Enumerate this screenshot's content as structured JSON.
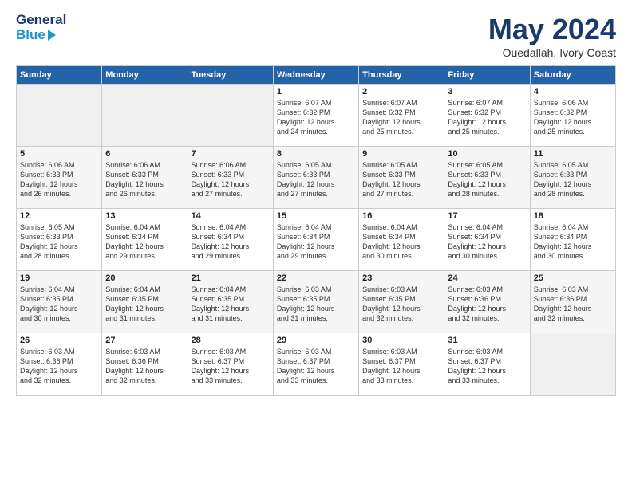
{
  "logo": {
    "line1": "General",
    "line2": "Blue"
  },
  "title": "May 2024",
  "location": "Ouedallah, Ivory Coast",
  "days_of_week": [
    "Sunday",
    "Monday",
    "Tuesday",
    "Wednesday",
    "Thursday",
    "Friday",
    "Saturday"
  ],
  "weeks": [
    [
      {
        "day": "",
        "info": ""
      },
      {
        "day": "",
        "info": ""
      },
      {
        "day": "",
        "info": ""
      },
      {
        "day": "1",
        "info": "Sunrise: 6:07 AM\nSunset: 6:32 PM\nDaylight: 12 hours\nand 24 minutes."
      },
      {
        "day": "2",
        "info": "Sunrise: 6:07 AM\nSunset: 6:32 PM\nDaylight: 12 hours\nand 25 minutes."
      },
      {
        "day": "3",
        "info": "Sunrise: 6:07 AM\nSunset: 6:32 PM\nDaylight: 12 hours\nand 25 minutes."
      },
      {
        "day": "4",
        "info": "Sunrise: 6:06 AM\nSunset: 6:32 PM\nDaylight: 12 hours\nand 25 minutes."
      }
    ],
    [
      {
        "day": "5",
        "info": "Sunrise: 6:06 AM\nSunset: 6:33 PM\nDaylight: 12 hours\nand 26 minutes."
      },
      {
        "day": "6",
        "info": "Sunrise: 6:06 AM\nSunset: 6:33 PM\nDaylight: 12 hours\nand 26 minutes."
      },
      {
        "day": "7",
        "info": "Sunrise: 6:06 AM\nSunset: 6:33 PM\nDaylight: 12 hours\nand 27 minutes."
      },
      {
        "day": "8",
        "info": "Sunrise: 6:05 AM\nSunset: 6:33 PM\nDaylight: 12 hours\nand 27 minutes."
      },
      {
        "day": "9",
        "info": "Sunrise: 6:05 AM\nSunset: 6:33 PM\nDaylight: 12 hours\nand 27 minutes."
      },
      {
        "day": "10",
        "info": "Sunrise: 6:05 AM\nSunset: 6:33 PM\nDaylight: 12 hours\nand 28 minutes."
      },
      {
        "day": "11",
        "info": "Sunrise: 6:05 AM\nSunset: 6:33 PM\nDaylight: 12 hours\nand 28 minutes."
      }
    ],
    [
      {
        "day": "12",
        "info": "Sunrise: 6:05 AM\nSunset: 6:33 PM\nDaylight: 12 hours\nand 28 minutes."
      },
      {
        "day": "13",
        "info": "Sunrise: 6:04 AM\nSunset: 6:34 PM\nDaylight: 12 hours\nand 29 minutes."
      },
      {
        "day": "14",
        "info": "Sunrise: 6:04 AM\nSunset: 6:34 PM\nDaylight: 12 hours\nand 29 minutes."
      },
      {
        "day": "15",
        "info": "Sunrise: 6:04 AM\nSunset: 6:34 PM\nDaylight: 12 hours\nand 29 minutes."
      },
      {
        "day": "16",
        "info": "Sunrise: 6:04 AM\nSunset: 6:34 PM\nDaylight: 12 hours\nand 30 minutes."
      },
      {
        "day": "17",
        "info": "Sunrise: 6:04 AM\nSunset: 6:34 PM\nDaylight: 12 hours\nand 30 minutes."
      },
      {
        "day": "18",
        "info": "Sunrise: 6:04 AM\nSunset: 6:34 PM\nDaylight: 12 hours\nand 30 minutes."
      }
    ],
    [
      {
        "day": "19",
        "info": "Sunrise: 6:04 AM\nSunset: 6:35 PM\nDaylight: 12 hours\nand 30 minutes."
      },
      {
        "day": "20",
        "info": "Sunrise: 6:04 AM\nSunset: 6:35 PM\nDaylight: 12 hours\nand 31 minutes."
      },
      {
        "day": "21",
        "info": "Sunrise: 6:04 AM\nSunset: 6:35 PM\nDaylight: 12 hours\nand 31 minutes."
      },
      {
        "day": "22",
        "info": "Sunrise: 6:03 AM\nSunset: 6:35 PM\nDaylight: 12 hours\nand 31 minutes."
      },
      {
        "day": "23",
        "info": "Sunrise: 6:03 AM\nSunset: 6:35 PM\nDaylight: 12 hours\nand 32 minutes."
      },
      {
        "day": "24",
        "info": "Sunrise: 6:03 AM\nSunset: 6:36 PM\nDaylight: 12 hours\nand 32 minutes."
      },
      {
        "day": "25",
        "info": "Sunrise: 6:03 AM\nSunset: 6:36 PM\nDaylight: 12 hours\nand 32 minutes."
      }
    ],
    [
      {
        "day": "26",
        "info": "Sunrise: 6:03 AM\nSunset: 6:36 PM\nDaylight: 12 hours\nand 32 minutes."
      },
      {
        "day": "27",
        "info": "Sunrise: 6:03 AM\nSunset: 6:36 PM\nDaylight: 12 hours\nand 32 minutes."
      },
      {
        "day": "28",
        "info": "Sunrise: 6:03 AM\nSunset: 6:37 PM\nDaylight: 12 hours\nand 33 minutes."
      },
      {
        "day": "29",
        "info": "Sunrise: 6:03 AM\nSunset: 6:37 PM\nDaylight: 12 hours\nand 33 minutes."
      },
      {
        "day": "30",
        "info": "Sunrise: 6:03 AM\nSunset: 6:37 PM\nDaylight: 12 hours\nand 33 minutes."
      },
      {
        "day": "31",
        "info": "Sunrise: 6:03 AM\nSunset: 6:37 PM\nDaylight: 12 hours\nand 33 minutes."
      },
      {
        "day": "",
        "info": ""
      }
    ]
  ]
}
